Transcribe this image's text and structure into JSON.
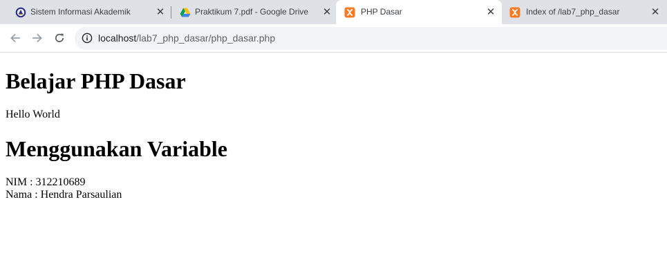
{
  "browser": {
    "tabs": [
      {
        "title": "Sistem Informasi Akademik",
        "icon": "university-seal-icon",
        "active": false
      },
      {
        "title": "Praktikum 7.pdf - Google Drive",
        "icon": "google-drive-icon",
        "active": false
      },
      {
        "title": "PHP Dasar",
        "icon": "xampp-icon",
        "active": true
      },
      {
        "title": "Index of /lab7_php_dasar",
        "icon": "xampp-icon",
        "active": false
      }
    ],
    "address": {
      "host": "localhost",
      "path": "/lab7_php_dasar/php_dasar.php"
    },
    "colors": {
      "tabstrip": "#dee1e6",
      "omnibox": "#f1f3f4",
      "xampp_orange": "#fb7a24"
    }
  },
  "page": {
    "heading1": "Belajar PHP Dasar",
    "greeting": "Hello World",
    "heading2": "Menggunakan Variable",
    "nim_line": "NIM : 312210689",
    "nama_line": "Nama : Hendra Parsaulian"
  }
}
